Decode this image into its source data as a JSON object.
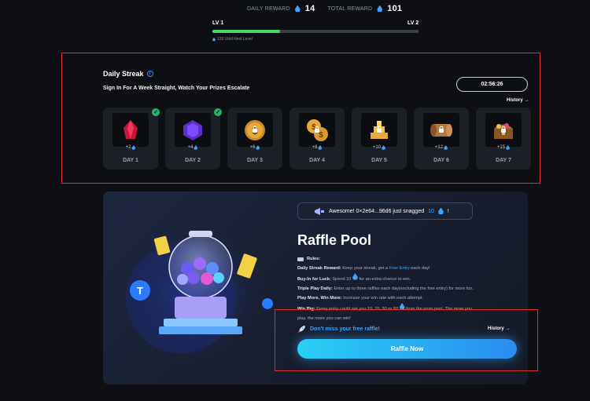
{
  "header": {
    "daily_reward_label": "DAILY REWARD",
    "daily_reward_value": "14",
    "total_reward_label": "TOTAL REWARD",
    "total_reward_value": "101",
    "level_current": "LV 1",
    "level_next": "LV 2",
    "level_progress": 0.33,
    "until_next": "139 Until Next Level"
  },
  "streak": {
    "title": "Daily Streak",
    "info_icon": "i",
    "subtitle": "Sign In For A Week Straight, Watch Your Prizes Escalate",
    "timer": "02:56:26",
    "history": "History →",
    "days": [
      {
        "amount": "+2",
        "label": "DAY 1",
        "icon": "ruby-icon",
        "done": true
      },
      {
        "amount": "+4",
        "label": "DAY 2",
        "icon": "amethyst-icon",
        "done": true
      },
      {
        "amount": "+6",
        "label": "DAY 3",
        "icon": "coin-icon",
        "done": false
      },
      {
        "amount": "+8",
        "label": "DAY 4",
        "icon": "coins-icon",
        "done": false
      },
      {
        "amount": "+10",
        "label": "DAY 5",
        "icon": "gold-bars-icon",
        "done": false
      },
      {
        "amount": "+12",
        "label": "DAY 6",
        "icon": "scroll-icon",
        "done": false
      },
      {
        "amount": "+15",
        "label": "DAY 7",
        "icon": "treasure-chest-icon",
        "done": false
      }
    ]
  },
  "raffle": {
    "toast_prefix": "Awesome! 0×2e64...96d6 just snagged",
    "toast_amount": "10",
    "toast_suffix": "!",
    "title": "Raffle Pool",
    "rules_label": "Rules:",
    "rules": [
      {
        "bold": "Daily Streak Reward:",
        "text1": " Keep your streak, get a ",
        "blue": "Free Entry",
        "text2": " each day!"
      },
      {
        "bold": "Buy-In for Luck:",
        "text1": " Spend 10",
        "blue": "",
        "text2": " for an extra chance to win."
      },
      {
        "bold": "Triple Play Daily:",
        "text1": " Enter up to three raffles each day(excluding the free entry) for more fun.",
        "blue": "",
        "text2": ""
      },
      {
        "bold": "Play More, Win More:",
        "text1": " Increase your win rate with each attempt.",
        "blue": "",
        "text2": ""
      },
      {
        "bold": "Win Big:",
        "text1": " Every entry could net you 10, 15, 30 or 50",
        "blue": "",
        "text2": " from the prize pool. The more you"
      }
    ],
    "rules_tail": "play, the more you can win!",
    "dont_miss": "Don't miss your free raffle!",
    "history": "History →",
    "button": "Raffle Now"
  },
  "colors": {
    "accent": "#3aa6ff",
    "green": "#4ad66a",
    "highlight_border": "#e52c2c"
  }
}
